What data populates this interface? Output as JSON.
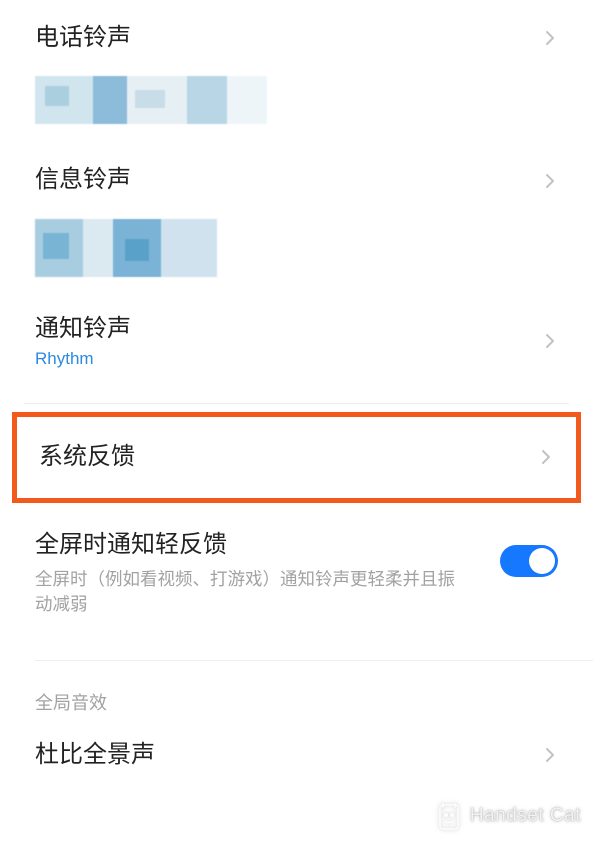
{
  "rows": {
    "phone": {
      "title": "电话铃声"
    },
    "msg": {
      "title": "信息铃声"
    },
    "notif": {
      "title": "通知铃声",
      "sub": "Rhythm"
    },
    "sys": {
      "title": "系统反馈"
    },
    "fullscreen": {
      "title": "全屏时通知轻反馈",
      "desc": "全屏时（例如看视频、打游戏）通知铃声更轻柔并且振动减弱",
      "toggle": true
    },
    "dolby": {
      "title": "杜比全景声"
    }
  },
  "section": {
    "global_audio": "全局音效"
  },
  "watermark": {
    "text": "Handset Cat"
  },
  "colors": {
    "highlight": "#f25a1d",
    "link": "#2b8adf",
    "toggle_on": "#1677ff"
  }
}
